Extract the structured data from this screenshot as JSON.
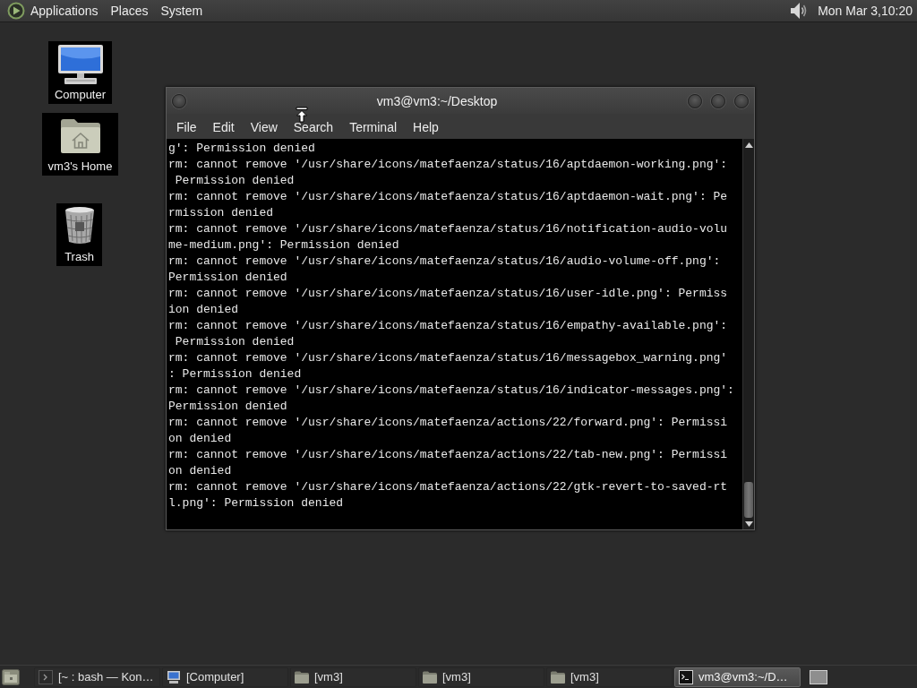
{
  "top_panel": {
    "menus": [
      "Applications",
      "Places",
      "System"
    ],
    "clock": "Mon Mar 3,10:20"
  },
  "desktop_icons": [
    {
      "kind": "computer",
      "label": "Computer"
    },
    {
      "kind": "home",
      "label": "vm3's Home"
    },
    {
      "kind": "trash",
      "label": "Trash"
    }
  ],
  "terminal": {
    "title": "vm3@vm3:~/Desktop",
    "menu": [
      "File",
      "Edit",
      "View",
      "Search",
      "Terminal",
      "Help"
    ],
    "lines": [
      "g': Permission denied",
      "rm: cannot remove '/usr/share/icons/matefaenza/status/16/aptdaemon-working.png':",
      " Permission denied",
      "rm: cannot remove '/usr/share/icons/matefaenza/status/16/aptdaemon-wait.png': Pe",
      "rmission denied",
      "rm: cannot remove '/usr/share/icons/matefaenza/status/16/notification-audio-volu",
      "me-medium.png': Permission denied",
      "rm: cannot remove '/usr/share/icons/matefaenza/status/16/audio-volume-off.png':",
      "Permission denied",
      "rm: cannot remove '/usr/share/icons/matefaenza/status/16/user-idle.png': Permiss",
      "ion denied",
      "rm: cannot remove '/usr/share/icons/matefaenza/status/16/empathy-available.png':",
      " Permission denied",
      "rm: cannot remove '/usr/share/icons/matefaenza/status/16/messagebox_warning.png'",
      ": Permission denied",
      "rm: cannot remove '/usr/share/icons/matefaenza/status/16/indicator-messages.png':",
      "Permission denied",
      "rm: cannot remove '/usr/share/icons/matefaenza/actions/22/forward.png': Permissi",
      "on denied",
      "rm: cannot remove '/usr/share/icons/matefaenza/actions/22/tab-new.png': Permissi",
      "on denied",
      "rm: cannot remove '/usr/share/icons/matefaenza/actions/22/gtk-revert-to-saved-rt",
      "l.png': Permission denied"
    ]
  },
  "taskbar": {
    "items": [
      {
        "kind": "console",
        "label": "[~ : bash — Kon…",
        "selected": false
      },
      {
        "kind": "computer",
        "label": "[Computer]",
        "selected": false
      },
      {
        "kind": "folder",
        "label": "[vm3]",
        "selected": false
      },
      {
        "kind": "folder",
        "label": "[vm3]",
        "selected": false
      },
      {
        "kind": "folder",
        "label": "[vm3]",
        "selected": false
      },
      {
        "kind": "terminal",
        "label": "vm3@vm3:~/D…",
        "selected": true
      }
    ]
  }
}
